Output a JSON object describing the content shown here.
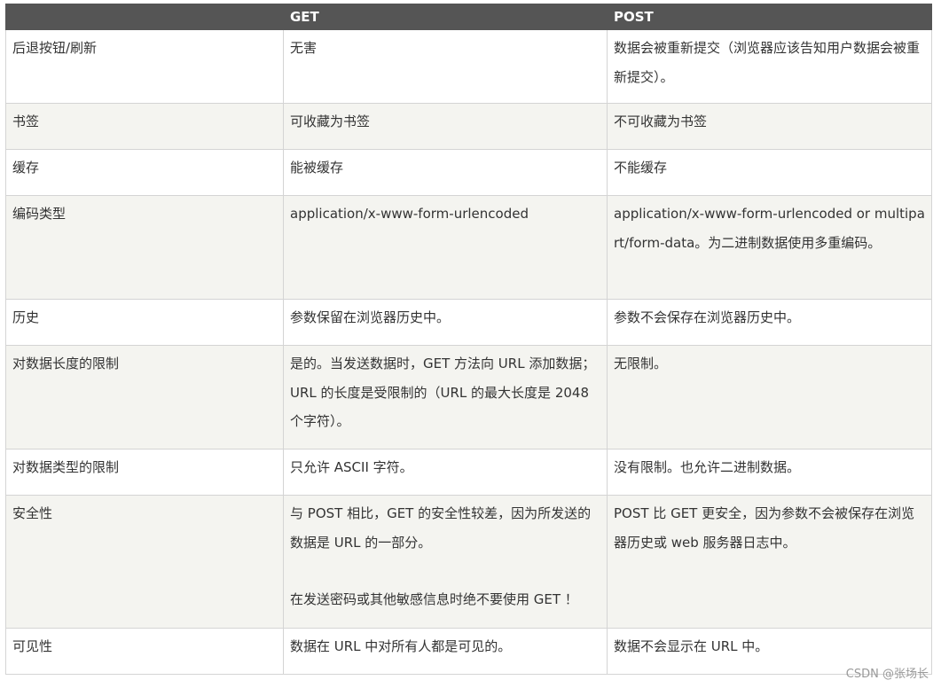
{
  "header": {
    "col1": "",
    "col2": "GET",
    "col3": "POST"
  },
  "rows": [
    {
      "label": "后退按钮/刷新",
      "get": [
        "无害"
      ],
      "post": [
        "数据会被重新提交（浏览器应该告知用户数据会被重新提交）。"
      ]
    },
    {
      "label": "书签",
      "get": [
        "可收藏为书签"
      ],
      "post": [
        "不可收藏为书签"
      ]
    },
    {
      "label": "缓存",
      "get": [
        "能被缓存"
      ],
      "post": [
        "不能缓存"
      ]
    },
    {
      "label": "编码类型",
      "get": [
        "application/x-www-form-urlencoded"
      ],
      "post": [
        "application/x-www-form-urlencoded or multipart/form-data。为二进制数据使用多重编码。"
      ]
    },
    {
      "label": "历史",
      "get": [
        "参数保留在浏览器历史中。"
      ],
      "post": [
        "参数不会保存在浏览器历史中。"
      ]
    },
    {
      "label": "对数据长度的限制",
      "get": [
        "是的。当发送数据时，GET 方法向 URL 添加数据；URL 的长度是受限制的（URL 的最大长度是 2048 个字符）。"
      ],
      "post": [
        "无限制。"
      ]
    },
    {
      "label": "对数据类型的限制",
      "get": [
        "只允许 ASCII 字符。"
      ],
      "post": [
        "没有限制。也允许二进制数据。"
      ]
    },
    {
      "label": "安全性",
      "get": [
        "与 POST 相比，GET 的安全性较差，因为所发送的数据是 URL 的一部分。",
        "在发送密码或其他敏感信息时绝不要使用 GET ！"
      ],
      "post": [
        "POST 比 GET 更安全，因为参数不会被保存在浏览器历史或 web 服务器日志中。"
      ]
    },
    {
      "label": "可见性",
      "get": [
        "数据在 URL 中对所有人都是可见的。"
      ],
      "post": [
        "数据不会显示在 URL 中。"
      ]
    }
  ],
  "watermark": "CSDN @张场长"
}
